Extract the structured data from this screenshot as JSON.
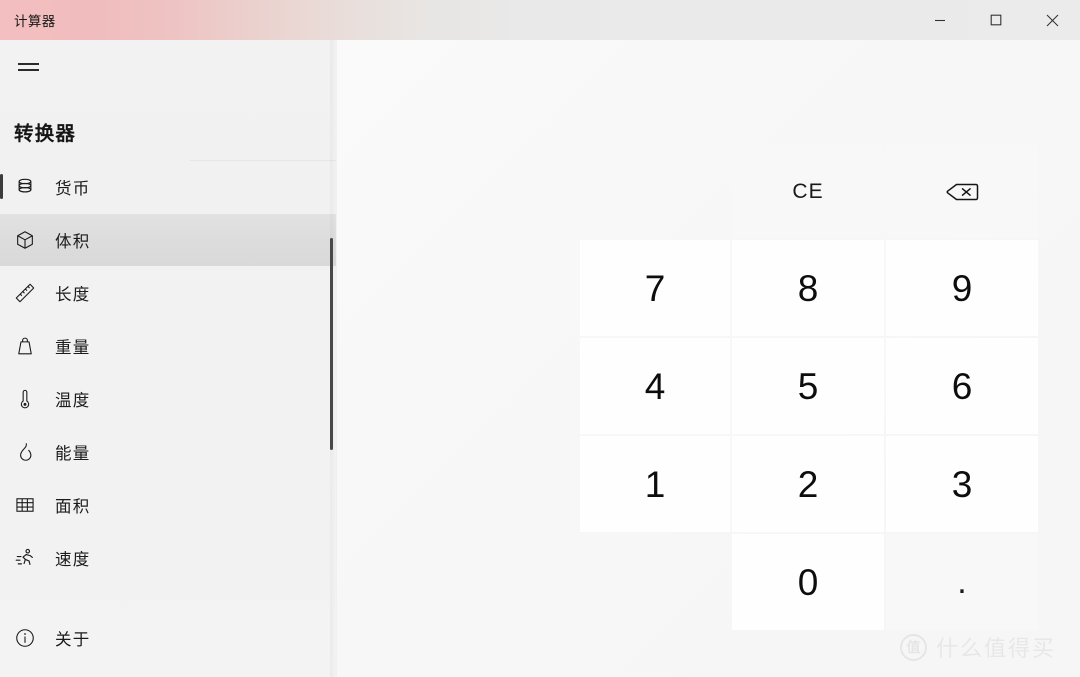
{
  "window": {
    "title": "计算器",
    "controls": [
      {
        "name": "minimize",
        "label": "—"
      },
      {
        "name": "maximize",
        "label": "□"
      },
      {
        "name": "close",
        "label": "✕"
      }
    ]
  },
  "nav": {
    "menu_label": "菜单",
    "header": "转换器",
    "items": [
      {
        "label": "货币",
        "icon": "coins-icon",
        "selected": false,
        "accented": true
      },
      {
        "label": "体积",
        "icon": "cube-icon",
        "selected": true,
        "accented": false
      },
      {
        "label": "长度",
        "icon": "ruler-icon",
        "selected": false,
        "accented": false
      },
      {
        "label": "重量",
        "icon": "weight-icon",
        "selected": false,
        "accented": false
      },
      {
        "label": "温度",
        "icon": "thermometer-icon",
        "selected": false,
        "accented": false
      },
      {
        "label": "能量",
        "icon": "flame-icon",
        "selected": false,
        "accented": false
      },
      {
        "label": "面积",
        "icon": "grid-icon",
        "selected": false,
        "accented": false
      },
      {
        "label": "速度",
        "icon": "runner-icon",
        "selected": false,
        "accented": false
      }
    ],
    "about": {
      "label": "关于",
      "icon": "info-icon"
    }
  },
  "keypad": {
    "clear_entry": "CE",
    "backspace_icon": "backspace-icon",
    "keys": [
      "7",
      "8",
      "9",
      "4",
      "5",
      "6",
      "1",
      "2",
      "3",
      "0",
      "."
    ]
  },
  "watermark": {
    "badge": "值",
    "text": "什么值得买"
  },
  "colors": {
    "title_accent": "#f3bfc0",
    "selected_row": "#dcdcdc",
    "accent_bar": "#3b3b3b",
    "key_text": "#0d0d0d",
    "watermark": "#dcdcdc"
  }
}
